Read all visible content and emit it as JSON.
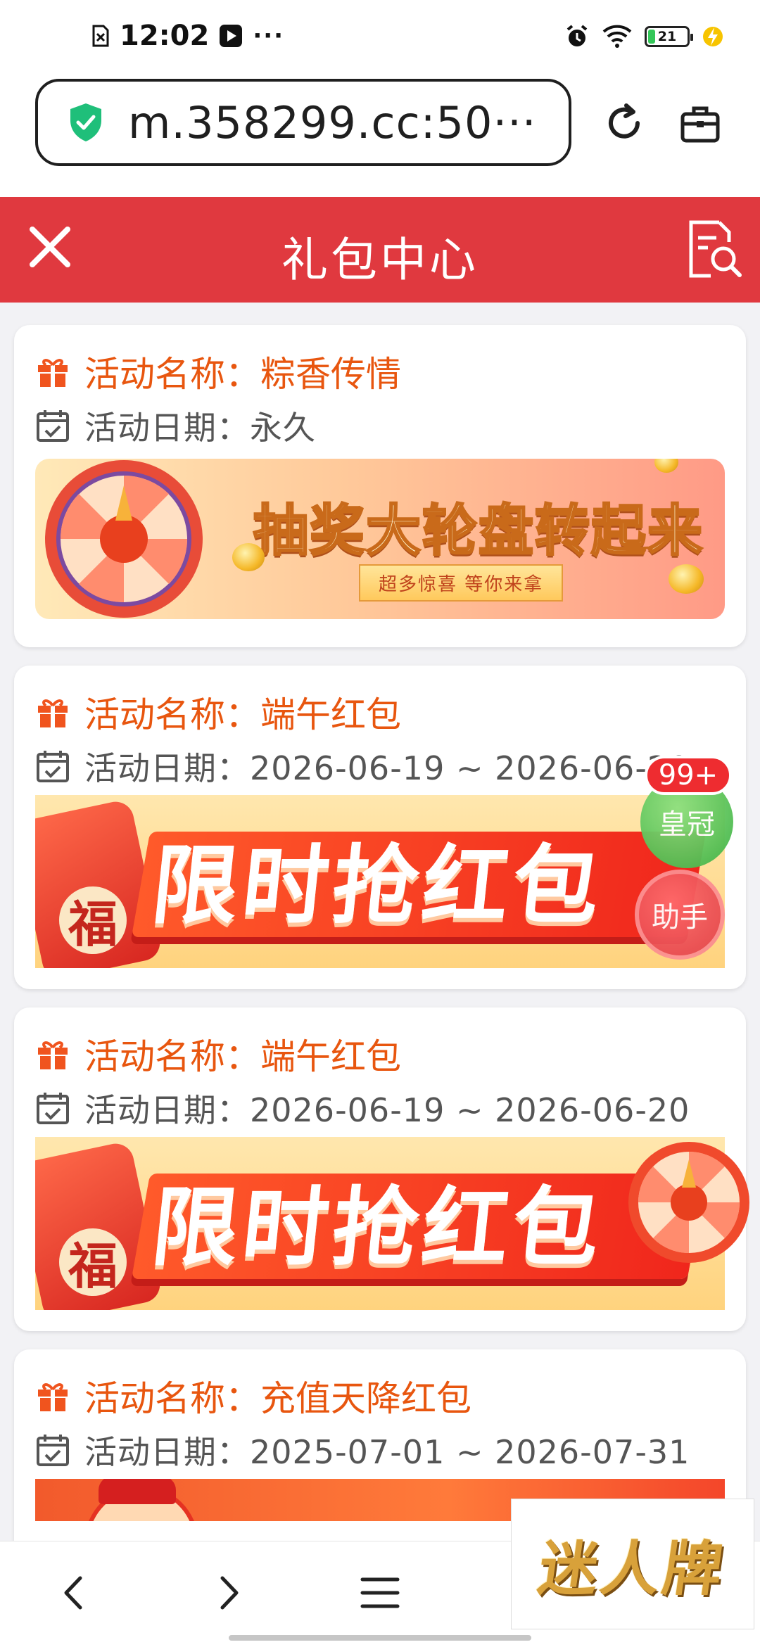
{
  "status_bar": {
    "time": "12:02",
    "more": "···",
    "battery": "21"
  },
  "browser": {
    "url": "m.358299.cc:50···"
  },
  "header": {
    "title": "礼包中心"
  },
  "activities": [
    {
      "name": "活动名称：粽香传情",
      "date": "活动日期：永久",
      "banner_title": "抽奖大轮盘转起来",
      "banner_subtitle": "超多惊喜 等你来拿"
    },
    {
      "name": "活动名称：端午红包",
      "date": "活动日期：2026-06-19 ~ 2026-06-20",
      "banner_title": "限时抢红包",
      "banner_badge": "福"
    },
    {
      "name": "活动名称：端午红包",
      "date": "活动日期：2026-06-19 ~ 2026-06-20",
      "banner_title": "限时抢红包",
      "banner_badge": "福"
    },
    {
      "name": "活动名称：充值天降红包",
      "date": "活动日期：2025-07-01 ~ 2026-07-31"
    }
  ],
  "floating": {
    "badge": "99+",
    "crown": "皇冠",
    "helper": "助手"
  },
  "ad": {
    "text": "迷人牌"
  },
  "colors": {
    "header_red": "#e0393f",
    "accent_orange": "#e8560f"
  }
}
